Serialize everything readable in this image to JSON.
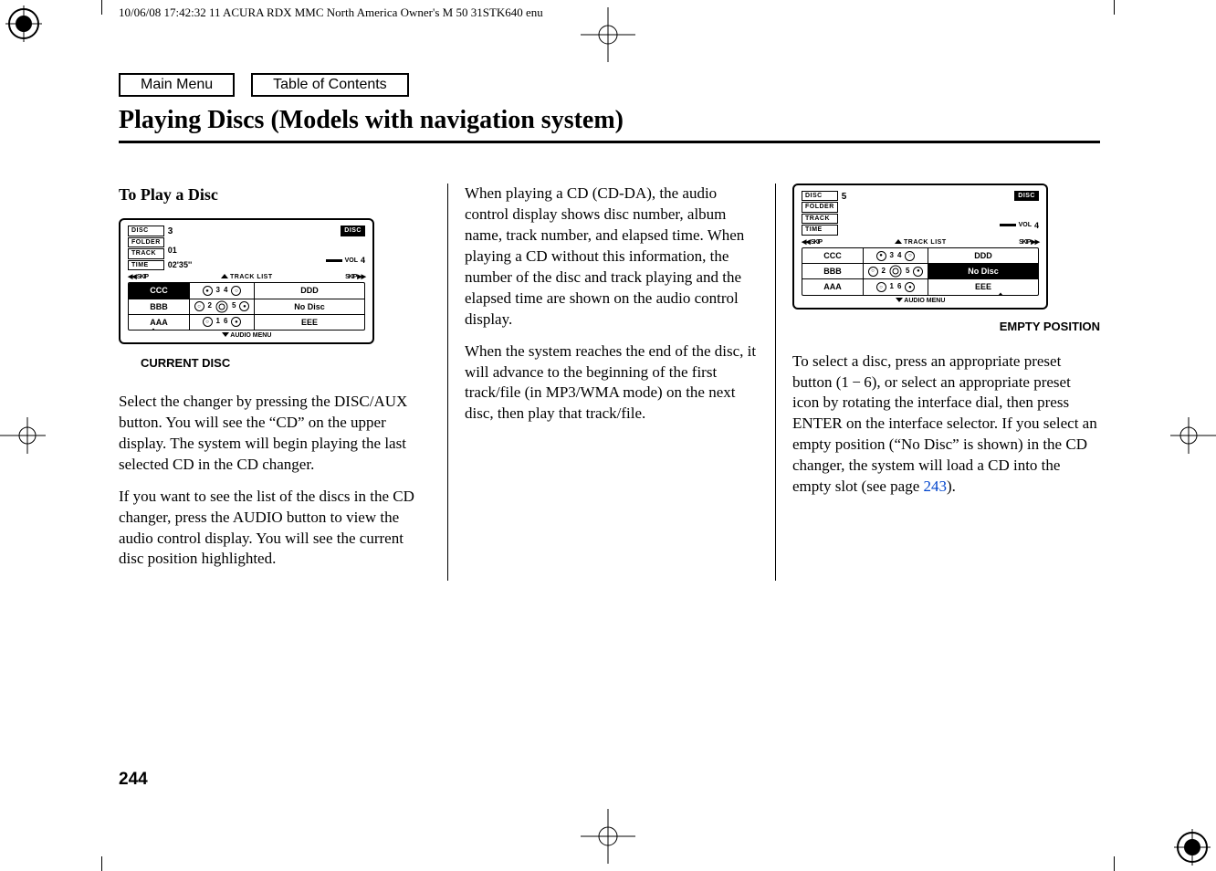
{
  "meta": {
    "timestamp": "10/06/08 17:42:32   11 ACURA RDX MMC North America Owner's M 50 31STK640 enu",
    "page_number": "244"
  },
  "buttons": {
    "main_menu": "Main Menu",
    "toc": "Table of Contents"
  },
  "title": "Playing Discs (Models with navigation system)",
  "col1": {
    "subhead": "To Play a Disc",
    "current_disc_label": "CURRENT DISC",
    "p1": "Select the changer by pressing the DISC/AUX button. You will see the “CD” on the upper display. The system will begin playing the last selected CD in the CD changer.",
    "p2": "If you want to see the list of the discs in the CD changer, press the AUDIO button to view the audio control display. You will see the current disc position highlighted."
  },
  "col2": {
    "p1": "When playing a CD (CD-DA), the audio control display shows disc number, album name, track number, and elapsed time. When playing a CD without this information, the number of the disc and track playing and the elapsed time are shown on the audio control display.",
    "p2": "When the system reaches the end of the disc, it will advance to the beginning of the first track/file (in MP3/WMA mode) on the next disc, then play that track/file."
  },
  "col3": {
    "empty_label": "EMPTY POSITION",
    "p1_a": "To select a disc, press an appropriate preset button (1 − 6), or select an appropriate preset icon by rotating the interface dial, then press ENTER on the interface selector. If you select an empty position (“No Disc” is shown) in the CD changer, the system will load a CD into the empty slot (see page ",
    "p1_link": "243",
    "p1_b": ")."
  },
  "display1": {
    "disc_label": "DISC",
    "folder_label": "FOLDER",
    "track_label": "TRACK",
    "time_label": "TIME",
    "disc_num": "3",
    "track_num": "01",
    "time_val": "02'35''",
    "badge": "DISC",
    "vol_label": "VOL",
    "vol_val": "4",
    "skip_back": "◀◀ SKIP",
    "track_list": "TRACK LIST",
    "skip_fwd": "SKIP ▶▶",
    "row1_left": "CCC",
    "row1_mid_a": "3",
    "row1_mid_b": "4",
    "row1_right": "DDD",
    "row2_left": "BBB",
    "row2_mid_a": "2",
    "row2_mid_b": "5",
    "row2_right": "No Disc",
    "row3_left": "AAA",
    "row3_mid_a": "1",
    "row3_mid_b": "6",
    "row3_right": "EEE",
    "audio_menu": "AUDIO MENU"
  },
  "display2": {
    "disc_label": "DISC",
    "folder_label": "FOLDER",
    "track_label": "TRACK",
    "time_label": "TIME",
    "disc_num": "5",
    "badge": "DISC",
    "vol_label": "VOL",
    "vol_val": "4",
    "skip_back": "◀◀ SKIP",
    "track_list": "TRACK LIST",
    "skip_fwd": "SKIP ▶▶",
    "row1_left": "CCC",
    "row1_mid_a": "3",
    "row1_mid_b": "4",
    "row1_right": "DDD",
    "row2_left": "BBB",
    "row2_mid_a": "2",
    "row2_mid_b": "5",
    "row2_right": "No Disc",
    "row3_left": "AAA",
    "row3_mid_a": "1",
    "row3_mid_b": "6",
    "row3_right": "EEE",
    "audio_menu": "AUDIO MENU"
  }
}
